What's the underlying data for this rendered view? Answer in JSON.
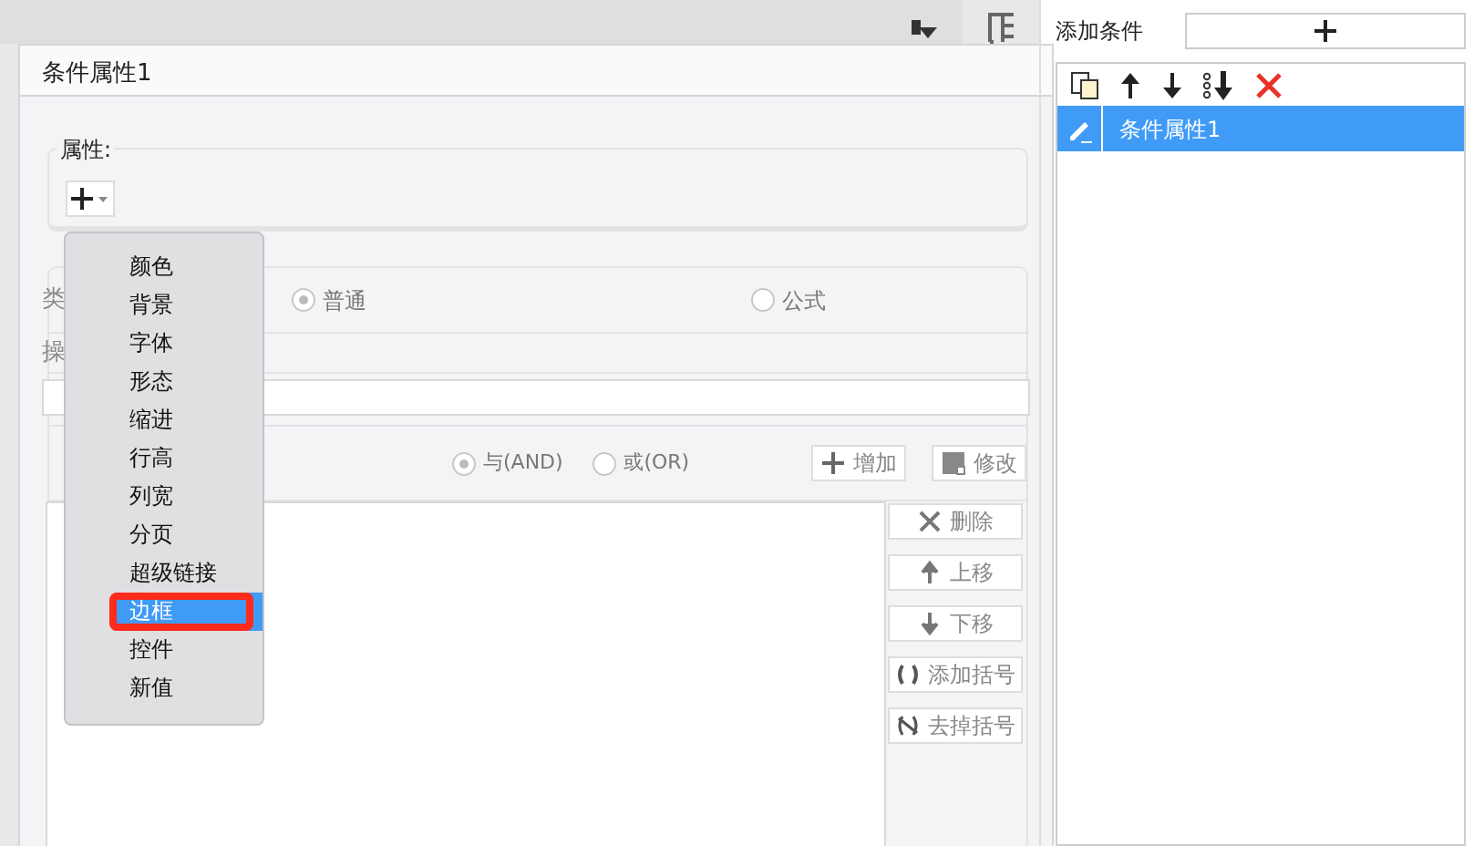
{
  "dialog": {
    "title": "条件属性1",
    "attributes_label": "属性:",
    "type_label": "类",
    "operator_label": "操",
    "type_options": [
      {
        "label": "普通",
        "selected": true
      },
      {
        "label": "公式",
        "selected": false
      }
    ],
    "logic_options": [
      {
        "label": "与(AND)",
        "selected": true
      },
      {
        "label": "或(OR)",
        "selected": false
      }
    ],
    "top_buttons": [
      {
        "kind": "add",
        "label": "增加"
      },
      {
        "kind": "edit",
        "label": "修改"
      }
    ],
    "side_buttons": [
      {
        "kind": "delete",
        "label": "删除"
      },
      {
        "kind": "up",
        "label": "上移"
      },
      {
        "kind": "down",
        "label": "下移"
      },
      {
        "kind": "paren",
        "label": "添加括号"
      },
      {
        "kind": "unparen",
        "label": "去掉括号"
      }
    ]
  },
  "menu": {
    "items": [
      {
        "label": "颜色",
        "selected": false
      },
      {
        "label": "背景",
        "selected": false
      },
      {
        "label": "字体",
        "selected": false
      },
      {
        "label": "形态",
        "selected": false
      },
      {
        "label": "缩进",
        "selected": false
      },
      {
        "label": "行高",
        "selected": false
      },
      {
        "label": "列宽",
        "selected": false
      },
      {
        "label": "分页",
        "selected": false
      },
      {
        "label": "超级链接",
        "selected": false
      },
      {
        "label": "边框",
        "selected": true
      },
      {
        "label": "控件",
        "selected": false
      },
      {
        "label": "新值",
        "selected": false
      }
    ]
  },
  "annotation": {
    "kind": "highlight-box"
  },
  "right_panel": {
    "title": "添加条件",
    "conditions": [
      {
        "label": "条件属性1",
        "selected": true
      }
    ]
  }
}
